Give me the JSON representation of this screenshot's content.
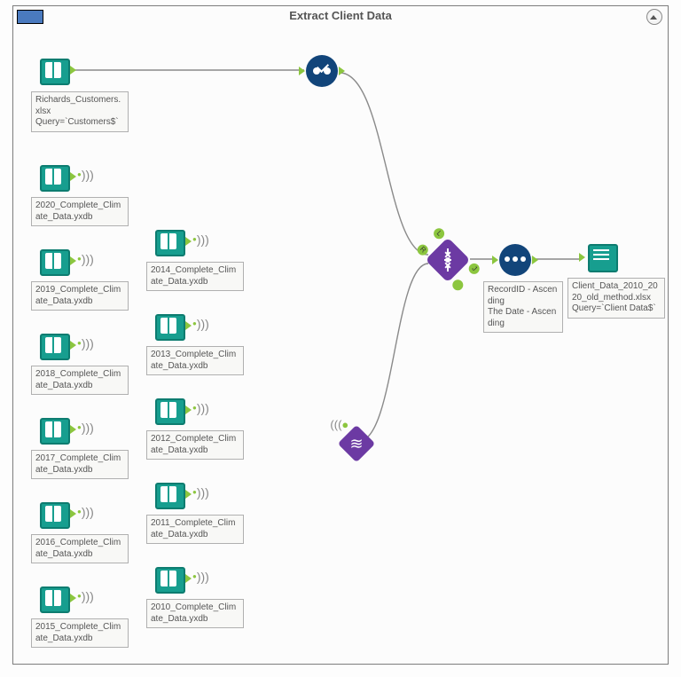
{
  "container": {
    "title": "Extract Client Data"
  },
  "inputs": {
    "main": {
      "label": "Richards_Customers.xlsx\nQuery=`Customers$`"
    },
    "y2020": {
      "label": "2020_Complete_Climate_Data.yxdb"
    },
    "y2019": {
      "label": "2019_Complete_Climate_Data.yxdb"
    },
    "y2018": {
      "label": "2018_Complete_Climate_Data.yxdb"
    },
    "y2017": {
      "label": "2017_Complete_Climate_Data.yxdb"
    },
    "y2016": {
      "label": "2016_Complete_Climate_Data.yxdb"
    },
    "y2015": {
      "label": "2015_Complete_Climate_Data.yxdb"
    },
    "y2014": {
      "label": "2014_Complete_Climate_Data.yxdb"
    },
    "y2013": {
      "label": "2013_Complete_Climate_Data.yxdb"
    },
    "y2012": {
      "label": "2012_Complete_Climate_Data.yxdb"
    },
    "y2011": {
      "label": "2011_Complete_Climate_Data.yxdb"
    },
    "y2010": {
      "label": "2010_Complete_Climate_Data.yxdb"
    }
  },
  "tools": {
    "cleanse": {
      "name": "Data Cleansing"
    },
    "join": {
      "name": "Join Multiple",
      "anchors": {
        "L": "L",
        "J": "J",
        "R": "R",
        "O": " "
      }
    },
    "sort": {
      "name": "Sort",
      "config": "RecordID - Ascending\nThe Date - Ascending"
    },
    "macro": {
      "name": "Batch Macro"
    },
    "output": {
      "name": "Output Data",
      "config": "Client_Data_2010_2020_old_method.xlsx\nQuery=`Client Data$`"
    }
  }
}
